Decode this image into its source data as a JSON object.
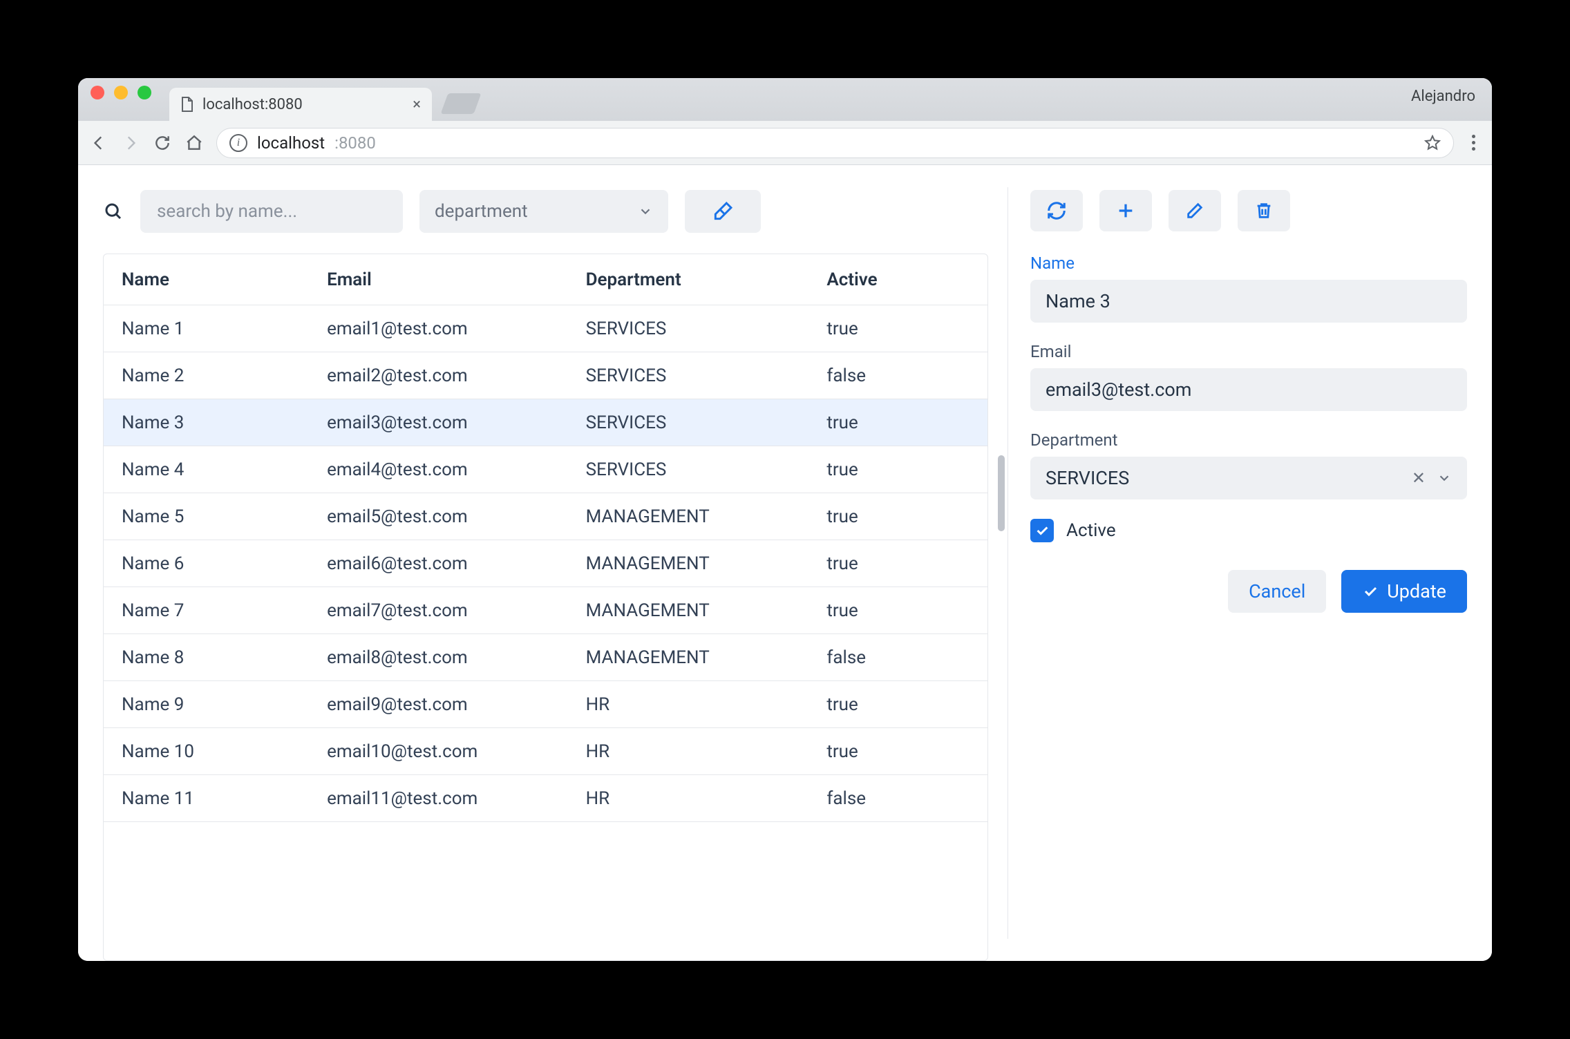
{
  "browser": {
    "tab_title": "localhost:8080",
    "profile": "Alejandro",
    "url_host": "localhost",
    "url_port": ":8080"
  },
  "search": {
    "placeholder": "search by name...",
    "dept_placeholder": "department"
  },
  "table": {
    "headers": {
      "name": "Name",
      "email": "Email",
      "department": "Department",
      "active": "Active"
    },
    "rows": [
      {
        "name": "Name 1",
        "email": "email1@test.com",
        "department": "SERVICES",
        "active": "true"
      },
      {
        "name": "Name 2",
        "email": "email2@test.com",
        "department": "SERVICES",
        "active": "false"
      },
      {
        "name": "Name 3",
        "email": "email3@test.com",
        "department": "SERVICES",
        "active": "true"
      },
      {
        "name": "Name 4",
        "email": "email4@test.com",
        "department": "SERVICES",
        "active": "true"
      },
      {
        "name": "Name 5",
        "email": "email5@test.com",
        "department": "MANAGEMENT",
        "active": "true"
      },
      {
        "name": "Name 6",
        "email": "email6@test.com",
        "department": "MANAGEMENT",
        "active": "true"
      },
      {
        "name": "Name 7",
        "email": "email7@test.com",
        "department": "MANAGEMENT",
        "active": "true"
      },
      {
        "name": "Name 8",
        "email": "email8@test.com",
        "department": "MANAGEMENT",
        "active": "false"
      },
      {
        "name": "Name 9",
        "email": "email9@test.com",
        "department": "HR",
        "active": "true"
      },
      {
        "name": "Name 10",
        "email": "email10@test.com",
        "department": "HR",
        "active": "true"
      },
      {
        "name": "Name 11",
        "email": "email11@test.com",
        "department": "HR",
        "active": "false"
      }
    ],
    "selected_index": 2
  },
  "form": {
    "labels": {
      "name": "Name",
      "email": "Email",
      "department": "Department",
      "active": "Active"
    },
    "values": {
      "name": "Name 3",
      "email": "email3@test.com",
      "department": "SERVICES",
      "active": true
    },
    "buttons": {
      "cancel": "Cancel",
      "update": "Update"
    }
  },
  "colors": {
    "accent": "#1a73e8"
  }
}
